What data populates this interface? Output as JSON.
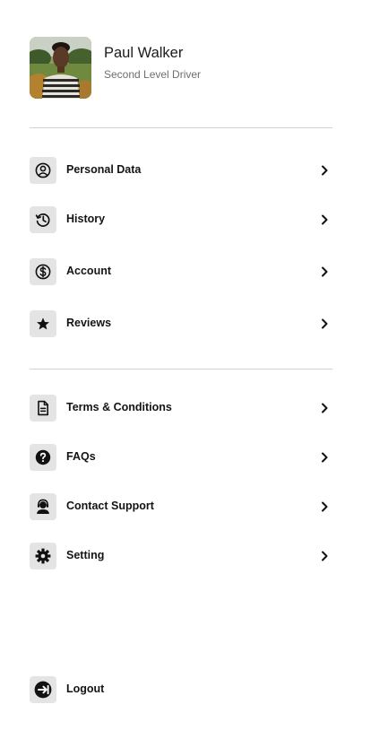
{
  "profile": {
    "name": "Paul Walker",
    "role": "Second Level Driver"
  },
  "menu_primary": [
    {
      "label": "Personal Data",
      "icon": "user-circle-icon"
    },
    {
      "label": "History",
      "icon": "history-icon"
    },
    {
      "label": "Account",
      "icon": "dollar-circle-icon"
    },
    {
      "label": "Reviews",
      "icon": "star-icon"
    }
  ],
  "menu_secondary": [
    {
      "label": "Terms & Conditions",
      "icon": "document-icon"
    },
    {
      "label": "FAQs",
      "icon": "question-circle-icon"
    },
    {
      "label": "Contact Support",
      "icon": "support-agent-icon"
    },
    {
      "label": "Setting",
      "icon": "gear-icon"
    }
  ],
  "logout": {
    "label": "Logout",
    "icon": "logout-icon"
  },
  "colors": {
    "icon_background": "#e4e4e4",
    "divider": "#d2d2d2",
    "text_primary": "#141414",
    "text_secondary": "#6f6f6f"
  }
}
